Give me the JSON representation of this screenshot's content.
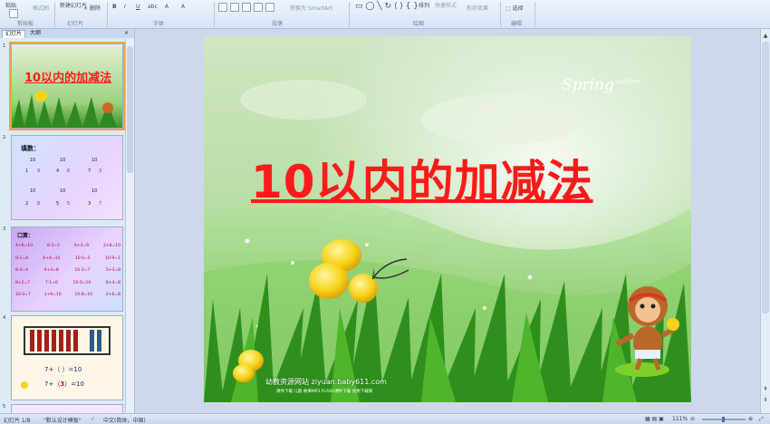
{
  "ribbon": {
    "paste": "粘贴",
    "format_painter": "格式刷",
    "new_slide": "新建幻灯片",
    "delete": "删除",
    "convert_smartart": "转换为 SmartArt",
    "arrange": "排列",
    "quick_styles": "快速样式",
    "shape_effects": "形状效果",
    "select": "选择",
    "groups": [
      "剪贴板",
      "幻灯片",
      "字体",
      "段落",
      "绘图",
      "编辑"
    ]
  },
  "panel": {
    "tab_slides": "幻灯片",
    "tab_outline": "大纲",
    "close": "×",
    "slide_numbers": [
      "1",
      "2",
      "3",
      "4",
      "5"
    ]
  },
  "thumbs": {
    "s1_title": "10以内的加减法",
    "s2": {
      "heading": "填数：",
      "top": [
        "10",
        "10",
        "10",
        "10",
        "10",
        "10"
      ],
      "pairs": [
        [
          "1",
          "9"
        ],
        [
          "4",
          "6"
        ],
        [
          "7",
          "3"
        ],
        [
          "2",
          "8"
        ],
        [
          "5",
          "5"
        ],
        [
          "3",
          "7"
        ]
      ]
    },
    "s3": {
      "heading": "口算：",
      "rows": [
        [
          "4+6=10",
          "8-3=5",
          "6+3=9",
          "2+8=10"
        ],
        [
          "9-1=8",
          "6+4=10",
          "10-5=5",
          "10-9=1"
        ],
        [
          "8-4=4",
          "4+4=8",
          "10-3=7",
          "5+3=8"
        ],
        [
          "8+2=7",
          "7-1=6",
          "10-0=10",
          "8+4=8"
        ],
        [
          "10-3=7",
          "1+9=10",
          "10-8=10",
          "2+6=8"
        ]
      ]
    },
    "s4": {
      "eq1": "7+（  ）=10",
      "eq2a": "7+（",
      "eq2b": "3",
      "eq2c": "）=10"
    }
  },
  "slide": {
    "title": "10以内的加减法",
    "watermark": "幼教资源网站 ziyuan.baby611.com",
    "watermark_sub": "课件下载 儿歌 故事MP3 FLASH课件下载 优秀下载网",
    "brand": "Spring",
    "brand_sub": "wallcoo"
  },
  "statusbar": {
    "slide_info": "幻灯片 1/8",
    "theme": "\"默认设计模板\"",
    "language": "中文(简体，中国)",
    "zoom": "111%"
  },
  "colors": {
    "title_red": "#ff1a1a",
    "accent_orange": "#f2a33c"
  }
}
